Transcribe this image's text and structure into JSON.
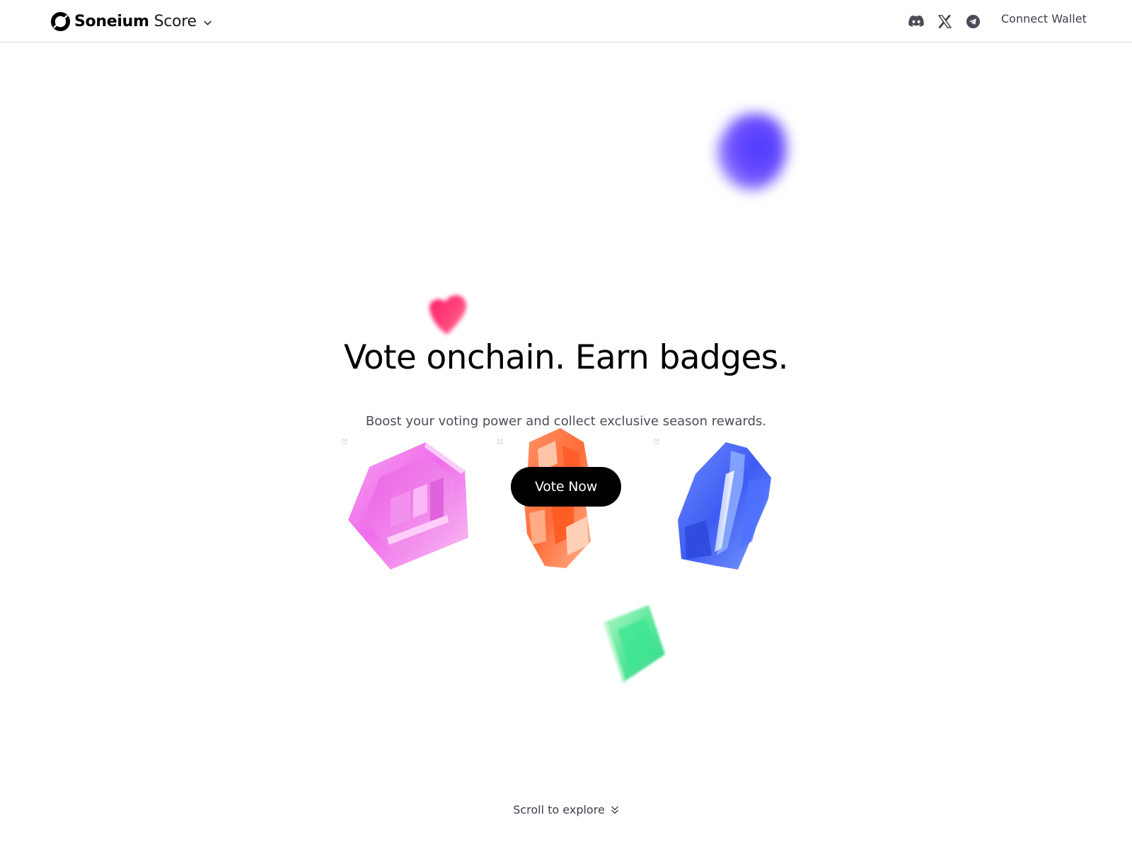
{
  "header": {
    "brand_name": "Soneium",
    "brand_product": "Score",
    "icons": {
      "logo": "soneium-logo-icon",
      "dropdown": "chevron-down-icon",
      "discord": "discord-icon",
      "x": "x-icon",
      "telegram": "telegram-icon"
    },
    "connect_wallet_label": "Connect Wallet"
  },
  "hero": {
    "title": "Vote onchain. Earn badges.",
    "subtitle": "Boost your voting power and collect exclusive season rewards.",
    "cta_label": "Vote Now"
  },
  "badges": [
    {
      "name": "pink-hexagon-badge",
      "color": "#f27ff5"
    },
    {
      "name": "orange-crystal-badge",
      "color": "#ff7a45"
    },
    {
      "name": "blue-crystal-badge",
      "color": "#4f6ef7"
    }
  ],
  "decorations": {
    "purple_blob_color": "#5b43ff",
    "heart_color": "#ff2d72",
    "green_cube_color": "#4de89a"
  },
  "footer": {
    "scroll_label": "Scroll to explore",
    "scroll_icon": "double-chevron-down-icon"
  }
}
